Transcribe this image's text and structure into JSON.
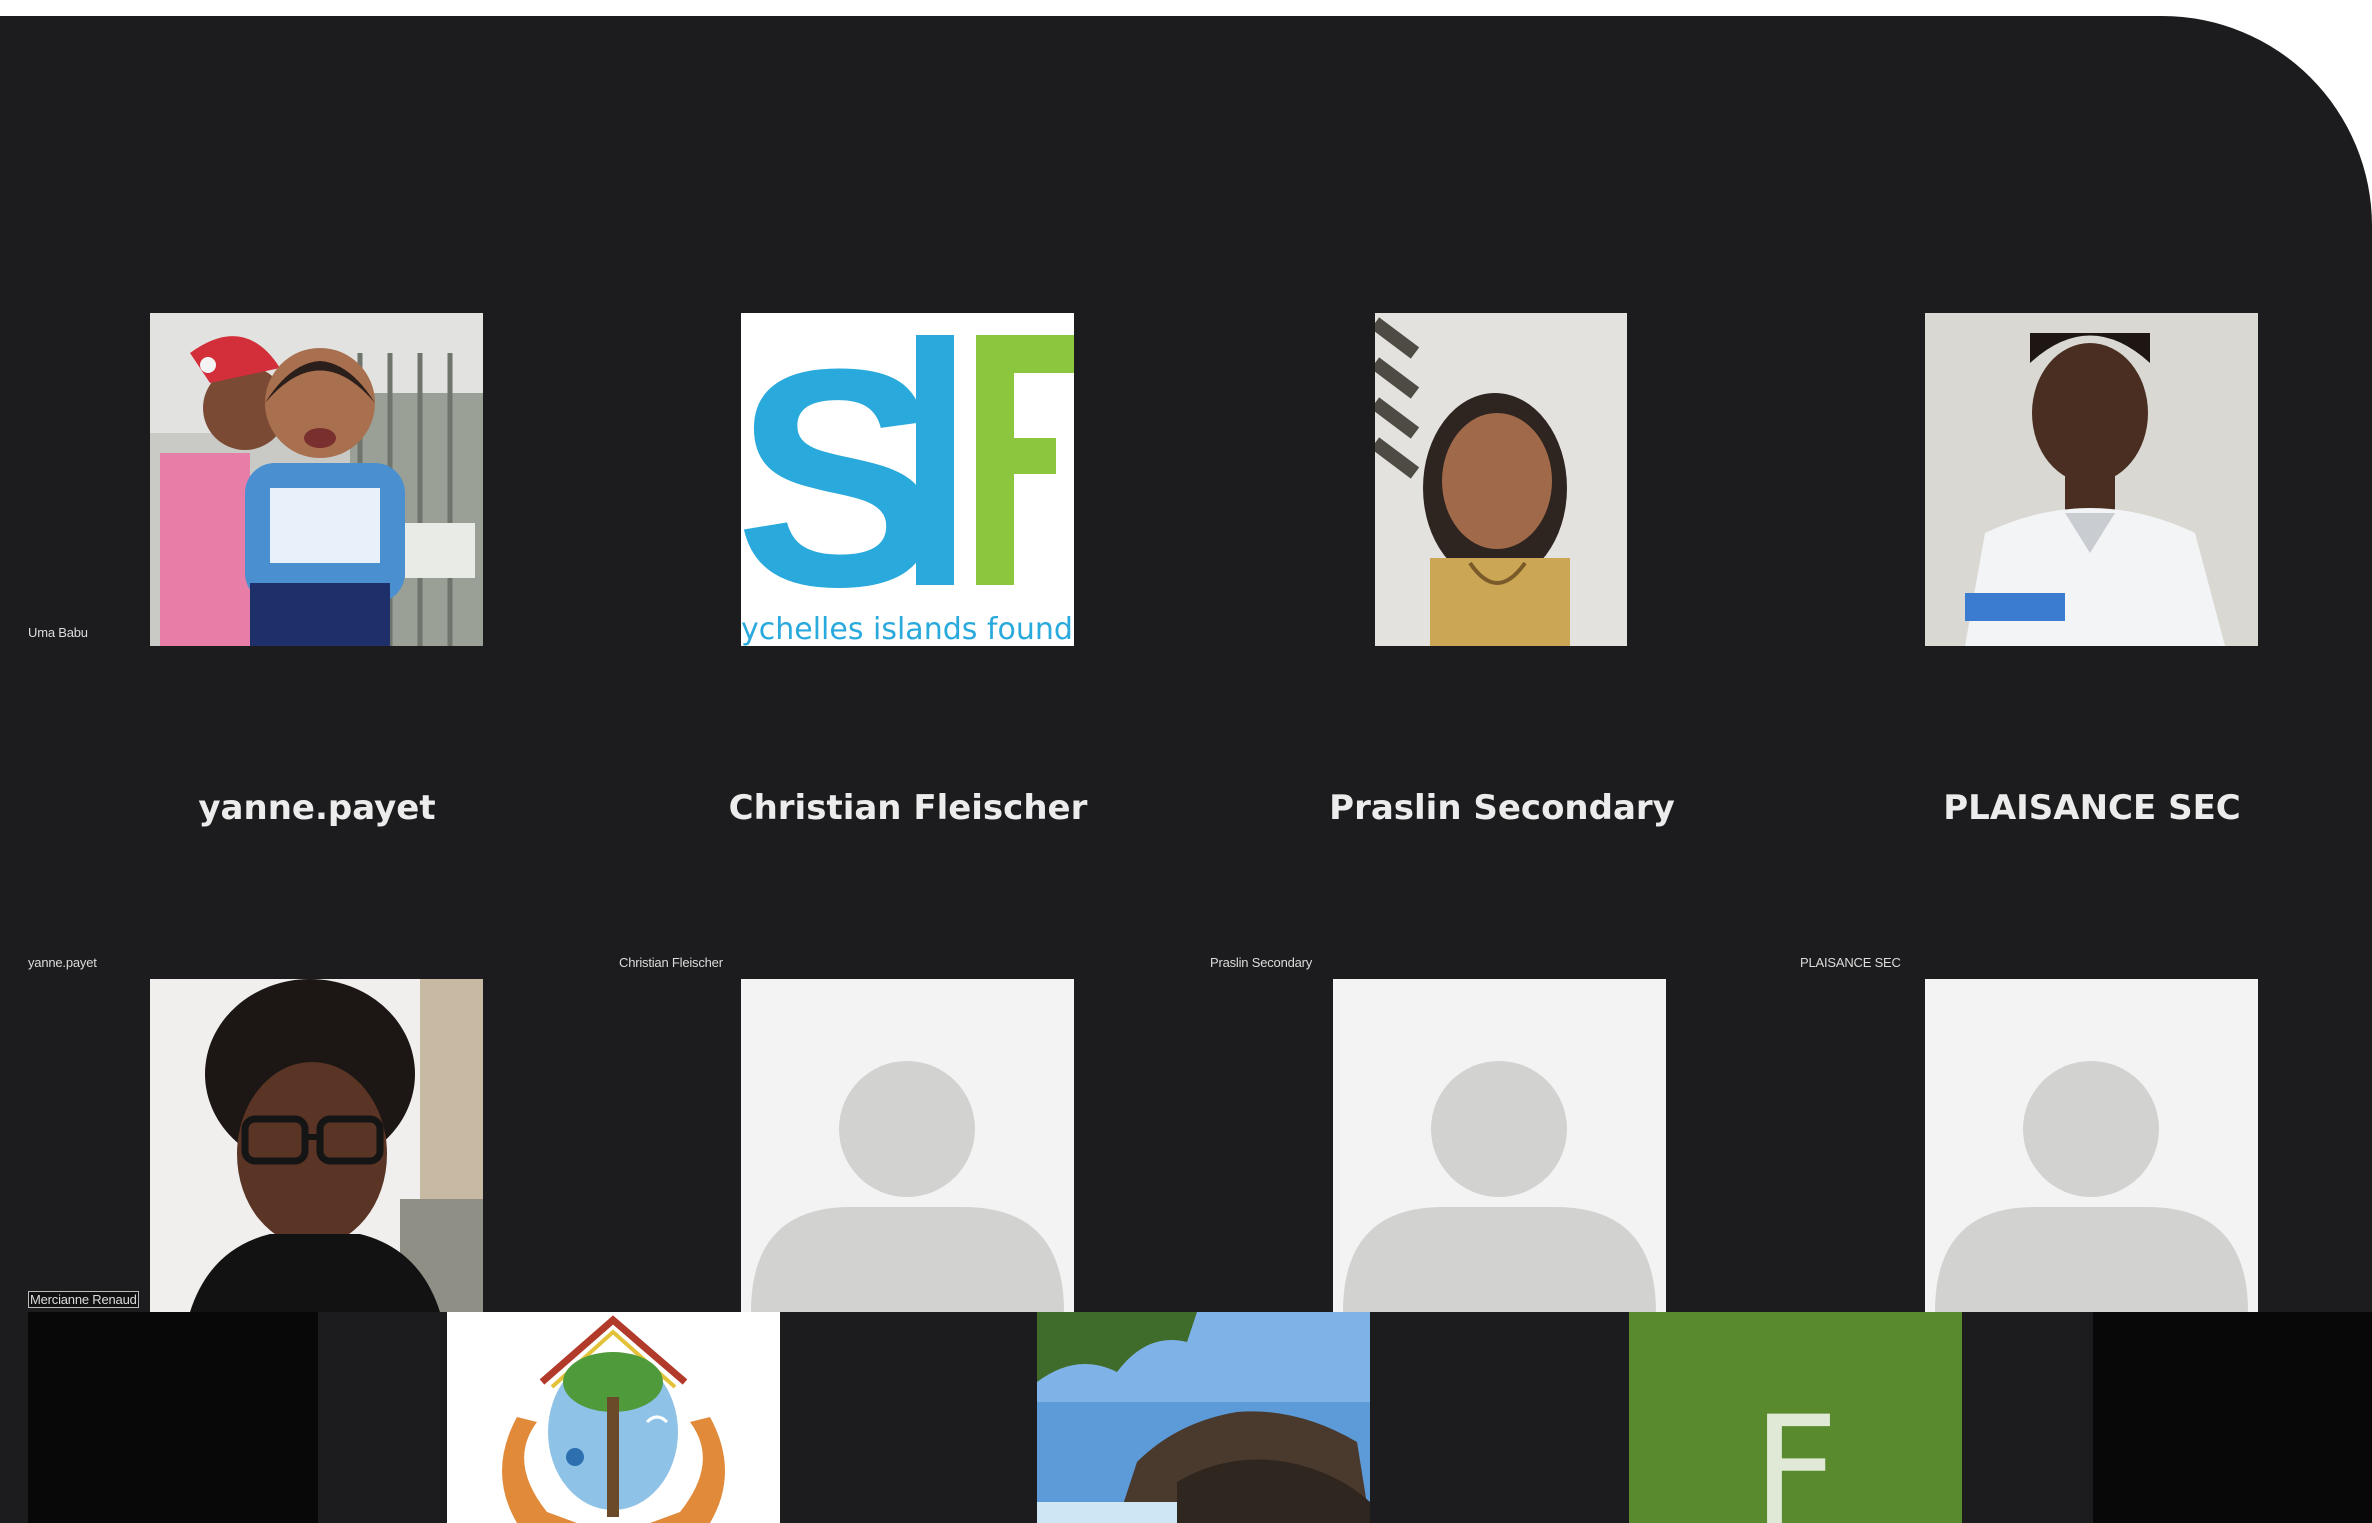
{
  "meeting": {
    "participants": [
      {
        "name": "Uma Babu",
        "kind": "photo",
        "avatar": "mother-and-baby-photo"
      },
      {
        "name": "yanne.payet",
        "kind": "logo",
        "avatar": "sif-logo",
        "logo_letters": "SIF",
        "logo_caption": "ychelles islands founda"
      },
      {
        "name": "Christian Fleischer",
        "kind": "photo",
        "avatar": "woman-portrait-photo"
      },
      {
        "name": "Praslin Secondary",
        "kind": "photo",
        "avatar": "student-uniform-photo"
      },
      {
        "name": "PLAISANCE SEC",
        "kind": "photo",
        "avatar": "woman-glasses-photo"
      },
      {
        "name": "Mercianne Renaud",
        "kind": "placeholder",
        "avatar": "default-avatar"
      }
    ],
    "center_names": [
      "yanne.payet",
      "Christian Fleischer",
      "Praslin Secondary",
      "PLAISANCE SEC"
    ],
    "row2_labels": [
      "yanne.payet",
      "Christian Fleischer",
      "Praslin Secondary",
      "PLAISANCE SEC"
    ],
    "bottom_strip": [
      {
        "kind": "dark"
      },
      {
        "kind": "logo",
        "avatar": "tree-hands-logo"
      },
      {
        "kind": "photo",
        "avatar": "rock-island-photo"
      },
      {
        "kind": "initial",
        "letter": "F",
        "color": "#5a8a2e"
      },
      {
        "kind": "dark"
      }
    ]
  },
  "colors": {
    "background": "#1c1b1d",
    "sif_blue": "#29a9dc",
    "sif_green": "#8cc63f"
  }
}
